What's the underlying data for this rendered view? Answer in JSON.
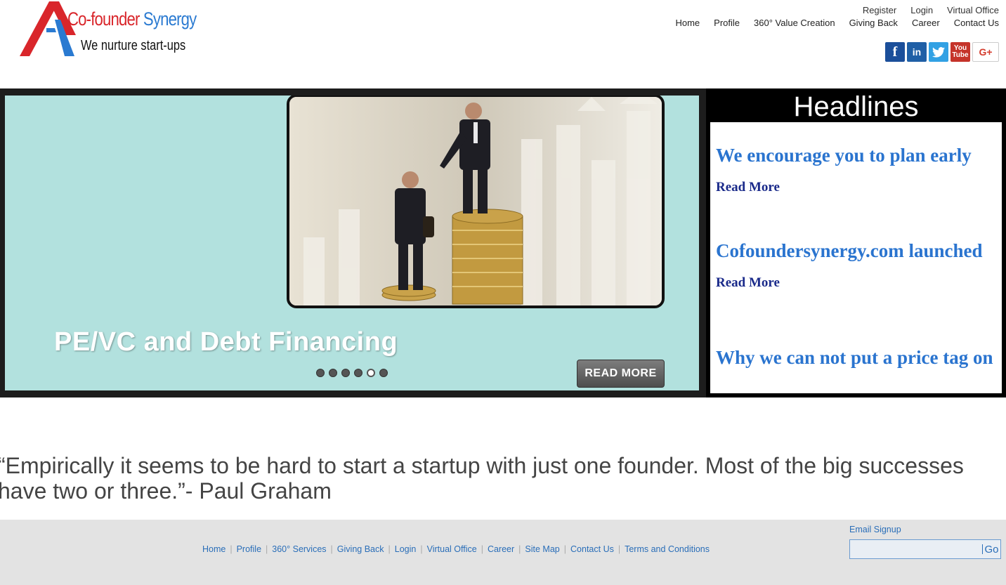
{
  "logo": {
    "name_part1": "Co-founder",
    "name_part2": "Synergy",
    "tagline": "We nurture start-ups"
  },
  "top_links": [
    "Register",
    "Login",
    "Virtual Office"
  ],
  "main_nav": [
    "Home",
    "Profile",
    "360° Value Creation",
    "Giving Back",
    "Career",
    "Contact Us"
  ],
  "social": [
    {
      "icon": "facebook-icon",
      "glyph": "f"
    },
    {
      "icon": "linkedin-icon",
      "glyph": "in"
    },
    {
      "icon": "twitter-icon",
      "glyph": "🐦"
    },
    {
      "icon": "youtube-icon",
      "glyph_top": "You",
      "glyph_bottom": "Tube"
    },
    {
      "icon": "google-plus-icon",
      "glyph": "G+"
    }
  ],
  "slider": {
    "title": "PE/VC and Debt Financing",
    "button_label": "READ MORE",
    "dot_count": 6,
    "active_dot": 5
  },
  "headlines": {
    "title": "Headlines",
    "items": [
      {
        "headline": "We encourage you to plan early",
        "link": "Read More"
      },
      {
        "headline": "Cofoundersynergy.com launched",
        "link": "Read More"
      },
      {
        "headline": "Why we can not put a price tag on",
        "link": ""
      }
    ]
  },
  "quote": "“Empirically it seems to be hard to start a startup with just one founder. Most of the big successes have two or three.”- Paul Graham",
  "footer": {
    "links": [
      "Home",
      "Profile",
      "360° Services",
      "Giving Back",
      "Login",
      "Virtual Office",
      "Career",
      "Site Map",
      "Contact Us",
      "Terms and Conditions"
    ],
    "signup_label": "Email Signup",
    "signup_button": "Go"
  },
  "colors": {
    "logo_red": "#d9262b",
    "logo_blue": "#2a7ad1",
    "slider_bg": "#b2e1de",
    "headline_blue": "#2a74cf",
    "readmore_navy": "#1a2a8a",
    "footer_bg": "#e3e3e3",
    "footer_link": "#2a6eb8"
  }
}
